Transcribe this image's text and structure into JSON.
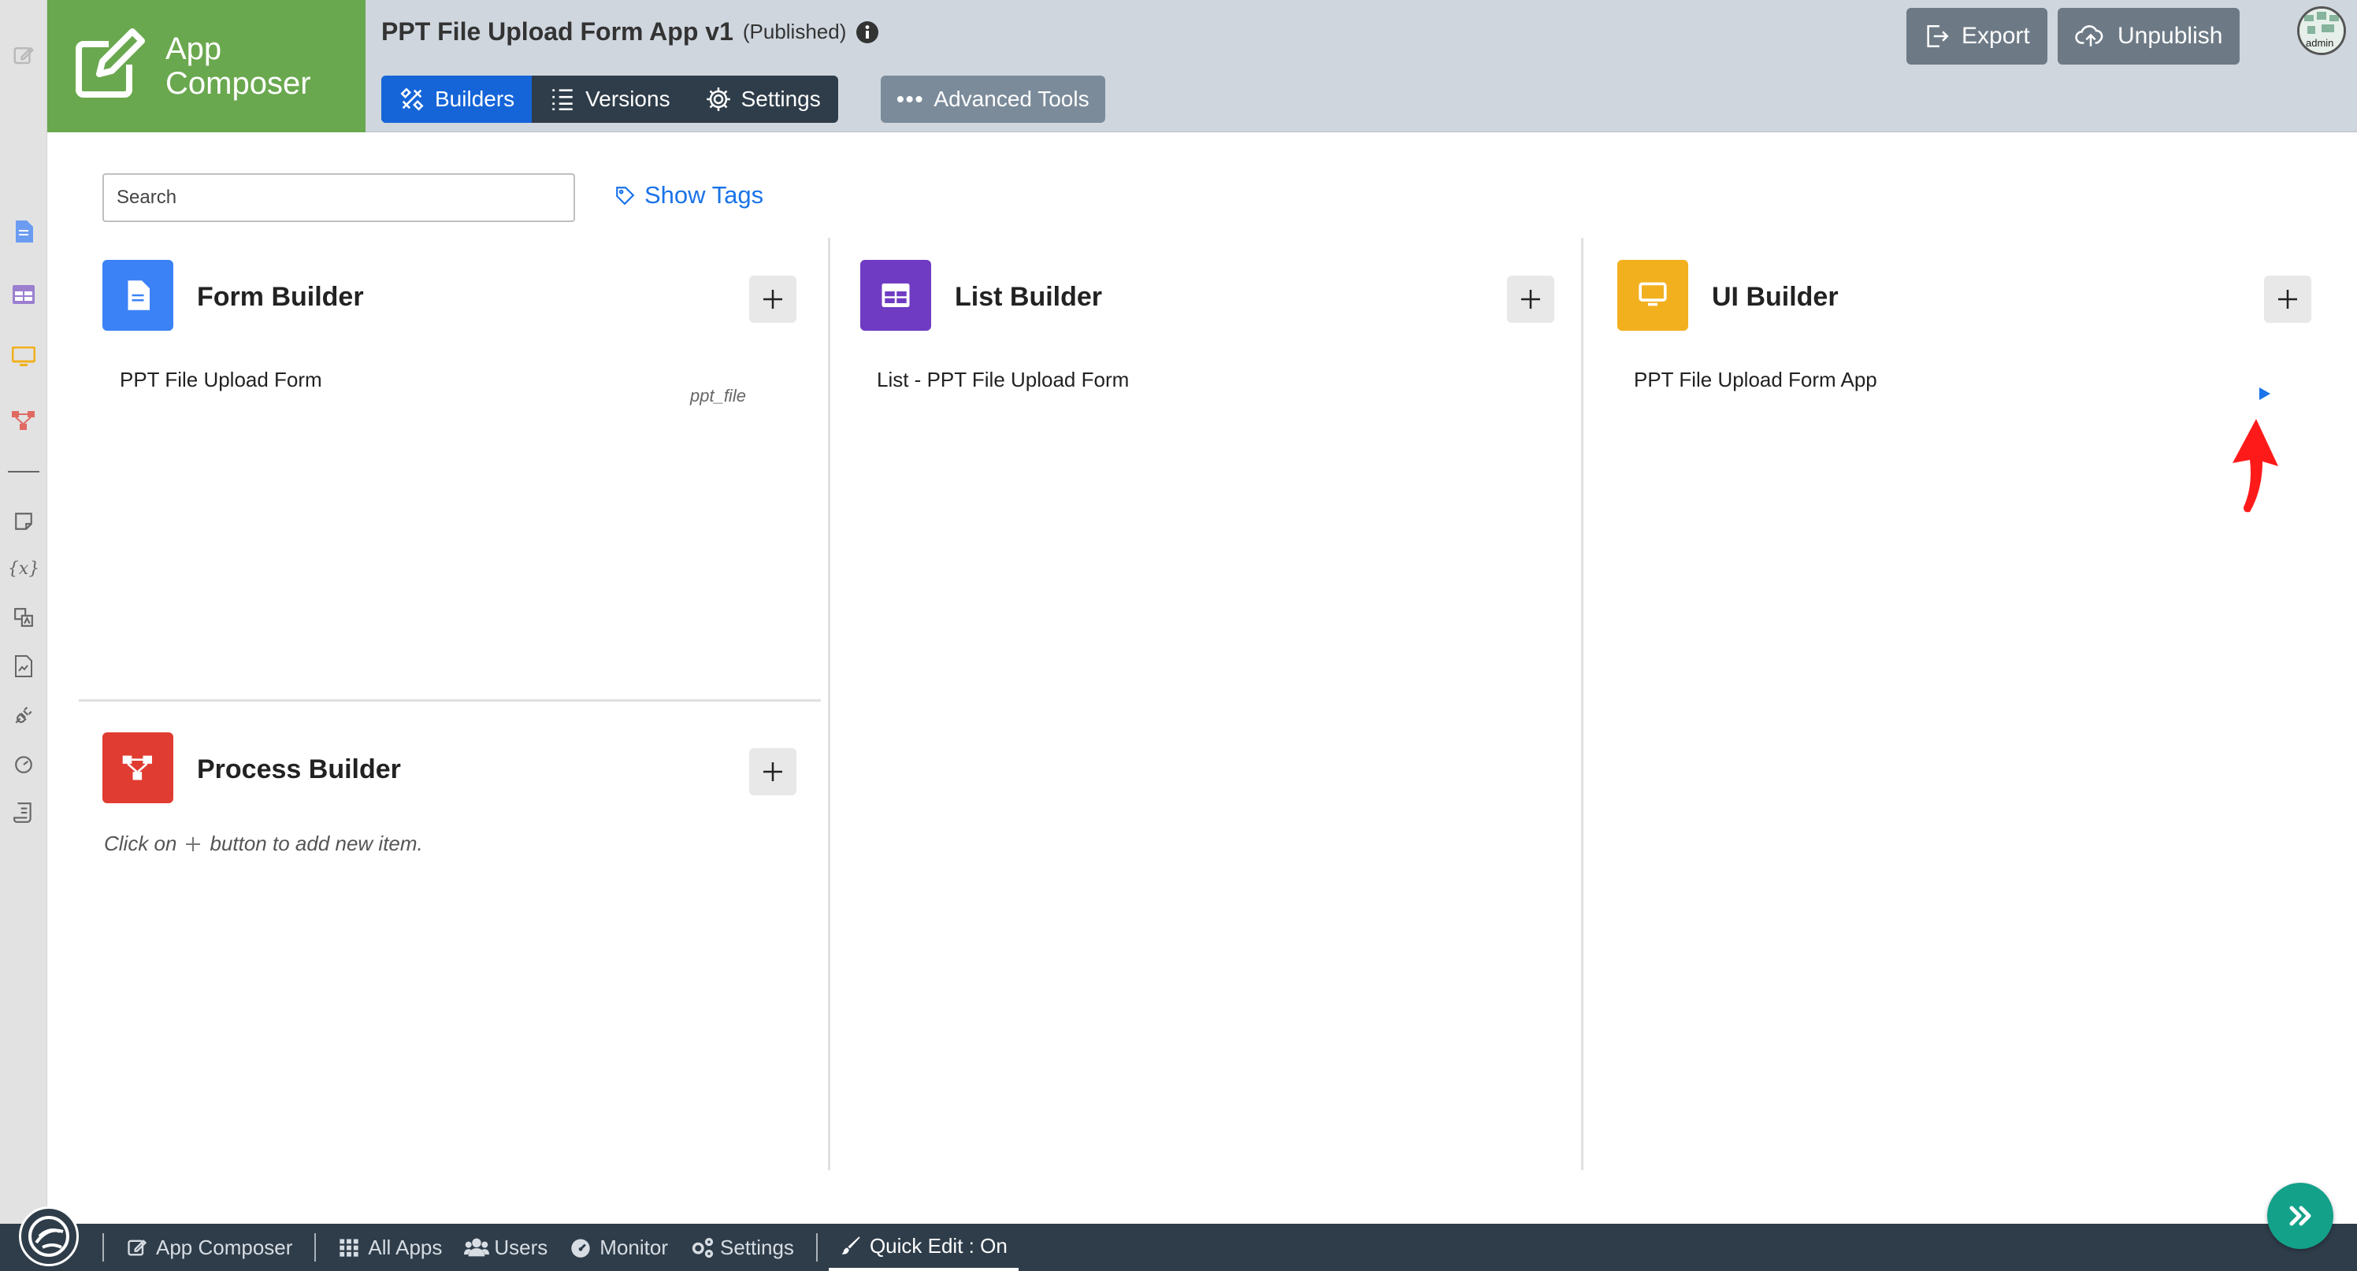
{
  "brand": {
    "name": "App Composer",
    "color": "#6aa84f"
  },
  "header": {
    "app_title": "PPT File Upload Form App v1",
    "status": "(Published)",
    "tabs": [
      {
        "label": "Builders",
        "icon": "tools-icon",
        "active": true
      },
      {
        "label": "Versions",
        "icon": "list-icon",
        "active": false
      },
      {
        "label": "Settings",
        "icon": "gear-icon",
        "active": false
      }
    ],
    "advanced_tools": "Advanced Tools",
    "export_label": "Export",
    "unpublish_label": "Unpublish",
    "avatar_label": "admin"
  },
  "toolbar": {
    "search_placeholder": "Search",
    "show_tags": "Show Tags"
  },
  "builders": {
    "form": {
      "title": "Form Builder",
      "color": "#3b82f6",
      "items": [
        {
          "label": "PPT File Upload Form",
          "tag": "ppt_file"
        }
      ]
    },
    "list": {
      "title": "List Builder",
      "color": "#6f3bc2",
      "items": [
        {
          "label": "List - PPT File Upload Form"
        }
      ]
    },
    "ui": {
      "title": "UI Builder",
      "color": "#f2b01e",
      "items": [
        {
          "label": "PPT File Upload Form App"
        }
      ]
    },
    "process": {
      "title": "Process Builder",
      "color": "#e03c31",
      "empty_hint_before": "Click on",
      "empty_hint_after": "button to add new item."
    }
  },
  "footer": {
    "items": [
      {
        "label": "App Composer",
        "icon": "edit-icon"
      },
      {
        "label": "All Apps",
        "icon": "grid-icon"
      },
      {
        "label": "Users",
        "icon": "users-icon"
      },
      {
        "label": "Monitor",
        "icon": "gauge-icon"
      },
      {
        "label": "Settings",
        "icon": "gears-icon"
      }
    ],
    "quick_edit": "Quick Edit : On"
  },
  "colors": {
    "primary": "#1565d8",
    "nav_dark": "#2f3d4a",
    "fab": "#13a189",
    "annotation_arrow": "#ff0000"
  }
}
